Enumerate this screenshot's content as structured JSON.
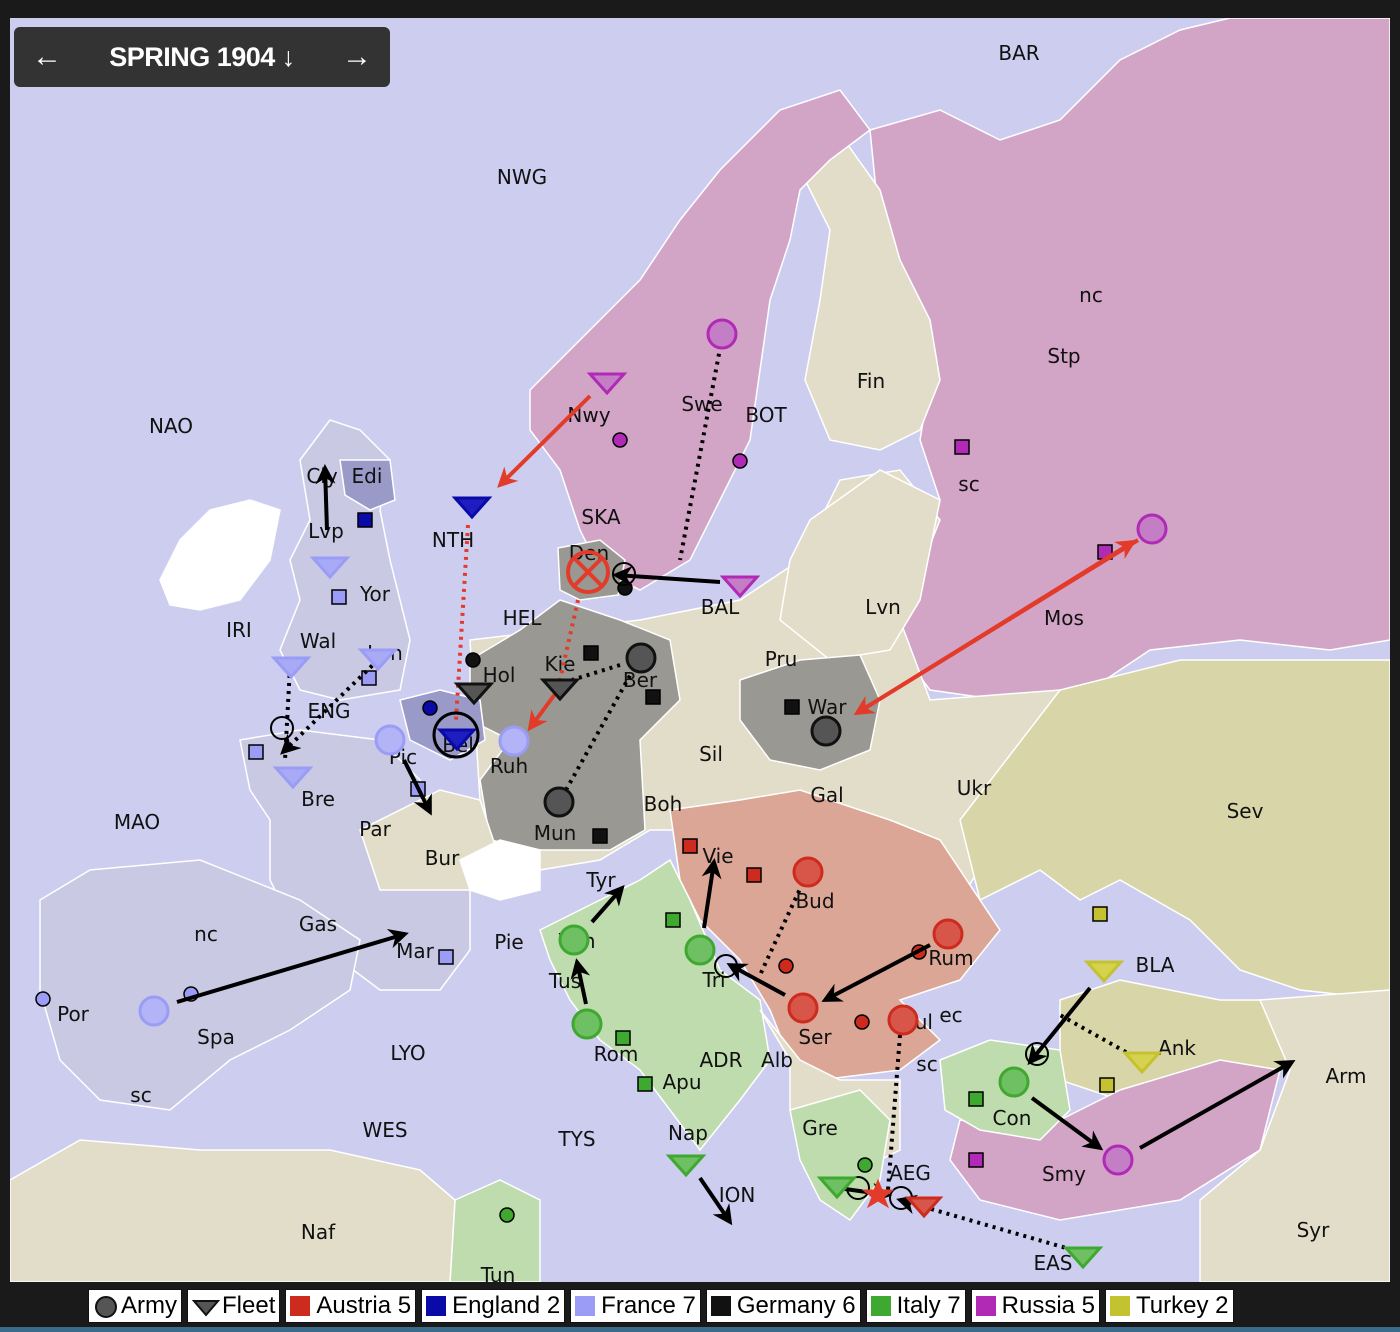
{
  "nav": {
    "season": "SPRING 1904 ↓",
    "prev_icon": "←",
    "next_icon": "→"
  },
  "legend": [
    {
      "name": "army",
      "label": "Army",
      "swatch": "army-icon"
    },
    {
      "name": "fleet",
      "label": "Fleet",
      "swatch": "fleet-icon"
    },
    {
      "name": "austria",
      "label": "Austria 5",
      "color": "#cc2b1d"
    },
    {
      "name": "england",
      "label": "England 2",
      "color": "#0a0aa8"
    },
    {
      "name": "france",
      "label": "France 7",
      "color": "#9a9cf5"
    },
    {
      "name": "germany",
      "label": "Germany 6",
      "color": "#111111"
    },
    {
      "name": "italy",
      "label": "Italy 7",
      "color": "#3fa830"
    },
    {
      "name": "russia",
      "label": "Russia 5",
      "color": "#b02ab5"
    },
    {
      "name": "turkey",
      "label": "Turkey 2",
      "color": "#c4c231"
    }
  ],
  "colors": {
    "sea": "#cdcdf0",
    "neutral": "#e2ddc8",
    "austria": "#dba696",
    "england": "#9a9ac8",
    "france": "#c9c9e3",
    "germany": "#999893",
    "italy": "#bedcad",
    "russia": "#d2a5c6",
    "turkey": "#d8d6a8"
  },
  "province_labels": [
    {
      "id": "BAR",
      "t": "BAR"
    },
    {
      "id": "NWG",
      "t": "NWG"
    },
    {
      "id": "NAO",
      "t": "NAO"
    },
    {
      "id": "nc_stp",
      "t": "nc"
    },
    {
      "id": "Stp",
      "t": "Stp"
    },
    {
      "id": "Fin",
      "t": "Fin"
    },
    {
      "id": "Swe",
      "t": "Swe"
    },
    {
      "id": "BOT",
      "t": "BOT"
    },
    {
      "id": "Nwy",
      "t": "Nwy"
    },
    {
      "id": "sc_stp",
      "t": "sc"
    },
    {
      "id": "Edi",
      "t": "Edi"
    },
    {
      "id": "Cly",
      "t": "Cly"
    },
    {
      "id": "NTH",
      "t": "NTH"
    },
    {
      "id": "SKA",
      "t": "SKA"
    },
    {
      "id": "Lvp",
      "t": "Lvp"
    },
    {
      "id": "Den",
      "t": "Den"
    },
    {
      "id": "Yor",
      "t": "Yor"
    },
    {
      "id": "BAL",
      "t": "BAL"
    },
    {
      "id": "Lvn",
      "t": "Lvn"
    },
    {
      "id": "Mos",
      "t": "Mos"
    },
    {
      "id": "IRI",
      "t": "IRI"
    },
    {
      "id": "Wal",
      "t": "Wal"
    },
    {
      "id": "HEL",
      "t": "HEL"
    },
    {
      "id": "Lon",
      "t": "Lon"
    },
    {
      "id": "Kie",
      "t": "Kie"
    },
    {
      "id": "Hol",
      "t": "Hol"
    },
    {
      "id": "Ber",
      "t": "Ber"
    },
    {
      "id": "Pru",
      "t": "Pru"
    },
    {
      "id": "ENG",
      "t": "ENG"
    },
    {
      "id": "War",
      "t": "War"
    },
    {
      "id": "Bel",
      "t": "Bel"
    },
    {
      "id": "Pic",
      "t": "Pic"
    },
    {
      "id": "Ruh",
      "t": "Ruh"
    },
    {
      "id": "Sil",
      "t": "Sil"
    },
    {
      "id": "Ukr",
      "t": "Ukr"
    },
    {
      "id": "Bre",
      "t": "Bre"
    },
    {
      "id": "Gal",
      "t": "Gal"
    },
    {
      "id": "Sev",
      "t": "Sev"
    },
    {
      "id": "MAO",
      "t": "MAO"
    },
    {
      "id": "Boh",
      "t": "Boh"
    },
    {
      "id": "Par",
      "t": "Par"
    },
    {
      "id": "Mun",
      "t": "Mun"
    },
    {
      "id": "Vie",
      "t": "Vie"
    },
    {
      "id": "Bur",
      "t": "Bur"
    },
    {
      "id": "Tyr",
      "t": "Tyr"
    },
    {
      "id": "Bud",
      "t": "Bud"
    },
    {
      "id": "nc_spa",
      "t": "nc"
    },
    {
      "id": "Gas",
      "t": "Gas"
    },
    {
      "id": "Ven",
      "t": "Ven"
    },
    {
      "id": "Pie",
      "t": "Pie"
    },
    {
      "id": "Mar",
      "t": "Mar"
    },
    {
      "id": "Rum",
      "t": "Rum"
    },
    {
      "id": "BLA",
      "t": "BLA"
    },
    {
      "id": "Tri",
      "t": "Tri"
    },
    {
      "id": "Tus",
      "t": "Tus"
    },
    {
      "id": "Por",
      "t": "Por"
    },
    {
      "id": "Spa",
      "t": "Spa"
    },
    {
      "id": "Bul",
      "t": "Bul"
    },
    {
      "id": "ec_bul",
      "t": "ec"
    },
    {
      "id": "Ser",
      "t": "Ser"
    },
    {
      "id": "Ank",
      "t": "Ank"
    },
    {
      "id": "LYO",
      "t": "LYO"
    },
    {
      "id": "Rom",
      "t": "Rom"
    },
    {
      "id": "ADR",
      "t": "ADR"
    },
    {
      "id": "Alb",
      "t": "Alb"
    },
    {
      "id": "sc_bul",
      "t": "sc"
    },
    {
      "id": "Arm",
      "t": "Arm"
    },
    {
      "id": "Apu",
      "t": "Apu"
    },
    {
      "id": "sc_spa",
      "t": "sc"
    },
    {
      "id": "Con",
      "t": "Con"
    },
    {
      "id": "WES",
      "t": "WES"
    },
    {
      "id": "TYS",
      "t": "TYS"
    },
    {
      "id": "Nap",
      "t": "Nap"
    },
    {
      "id": "Gre",
      "t": "Gre"
    },
    {
      "id": "AEG",
      "t": "AEG"
    },
    {
      "id": "Smy",
      "t": "Smy"
    },
    {
      "id": "ION",
      "t": "ION"
    },
    {
      "id": "Syr",
      "t": "Syr"
    },
    {
      "id": "Naf",
      "t": "Naf"
    },
    {
      "id": "EAS",
      "t": "EAS"
    },
    {
      "id": "Tun",
      "t": "Tun"
    }
  ],
  "units": [
    {
      "type": "fleet",
      "power": "russia",
      "at": "Nwy"
    },
    {
      "type": "army",
      "power": "russia",
      "at": "Swe"
    },
    {
      "type": "fleet",
      "power": "russia",
      "at": "BAL"
    },
    {
      "type": "army",
      "power": "russia",
      "at": "Mos"
    },
    {
      "type": "army",
      "power": "russia",
      "at": "Smy"
    },
    {
      "type": "fleet",
      "power": "england",
      "at": "NTH"
    },
    {
      "type": "fleet",
      "power": "england",
      "at": "Bel"
    },
    {
      "type": "fleet",
      "power": "france",
      "at": "Lvp"
    },
    {
      "type": "fleet",
      "power": "france",
      "at": "Wal"
    },
    {
      "type": "fleet",
      "power": "france",
      "at": "Lon"
    },
    {
      "type": "fleet",
      "power": "france",
      "at": "Bre"
    },
    {
      "type": "army",
      "power": "france",
      "at": "Pic"
    },
    {
      "type": "army",
      "power": "france",
      "at": "Ruh"
    },
    {
      "type": "army",
      "power": "france",
      "at": "Spa"
    },
    {
      "type": "army",
      "power": "germany",
      "at": "Den",
      "dislodged": true
    },
    {
      "type": "fleet",
      "power": "germany",
      "at": "Hol"
    },
    {
      "type": "fleet",
      "power": "germany",
      "at": "Kie"
    },
    {
      "type": "army",
      "power": "germany",
      "at": "Ber"
    },
    {
      "type": "army",
      "power": "germany",
      "at": "Mun"
    },
    {
      "type": "army",
      "power": "germany",
      "at": "War"
    },
    {
      "type": "army",
      "power": "austria",
      "at": "Bud"
    },
    {
      "type": "army",
      "power": "austria",
      "at": "Rum"
    },
    {
      "type": "army",
      "power": "austria",
      "at": "Ser"
    },
    {
      "type": "army",
      "power": "austria",
      "at": "Bul"
    },
    {
      "type": "fleet",
      "power": "austria",
      "at": "AEG"
    },
    {
      "type": "army",
      "power": "italy",
      "at": "Ven"
    },
    {
      "type": "army",
      "power": "italy",
      "at": "Rom"
    },
    {
      "type": "army",
      "power": "italy",
      "at": "Tri"
    },
    {
      "type": "army",
      "power": "italy",
      "at": "Con"
    },
    {
      "type": "fleet",
      "power": "italy",
      "at": "Nap"
    },
    {
      "type": "fleet",
      "power": "italy",
      "at": "Gre"
    },
    {
      "type": "fleet",
      "power": "italy",
      "at": "EAS"
    },
    {
      "type": "fleet",
      "power": "turkey",
      "at": "BLA"
    },
    {
      "type": "fleet",
      "power": "turkey",
      "at": "Ank"
    }
  ]
}
